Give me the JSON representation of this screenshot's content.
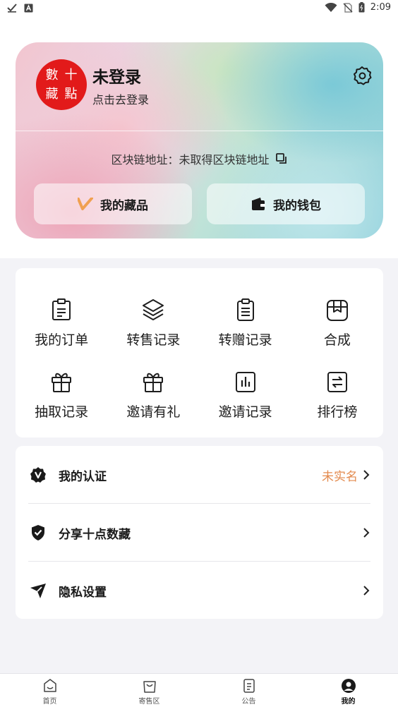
{
  "status_bar": {
    "time": "2:09",
    "left_icons": [
      "check-icon",
      "font-a-icon"
    ],
    "right_icons": [
      "wifi-icon",
      "no-sim-icon",
      "battery-icon"
    ]
  },
  "profile": {
    "avatar_chars": [
      "數",
      "十",
      "藏",
      "點"
    ],
    "name": "未登录",
    "login_hint": "点击去登录",
    "chain_address_label": "区块链地址：未取得区块链地址",
    "collection_button": "我的藏品",
    "wallet_button": "我的钱包"
  },
  "menu_grid": [
    {
      "label": "我的订单",
      "icon": "order-icon"
    },
    {
      "label": "转售记录",
      "icon": "layers-icon"
    },
    {
      "label": "转赠记录",
      "icon": "clipboard-icon"
    },
    {
      "label": "合成",
      "icon": "compose-icon"
    },
    {
      "label": "抽取记录",
      "icon": "gift-icon"
    },
    {
      "label": "邀请有礼",
      "icon": "gift-icon"
    },
    {
      "label": "邀请记录",
      "icon": "chart-icon"
    },
    {
      "label": "排行榜",
      "icon": "ranking-icon"
    }
  ],
  "list": [
    {
      "label": "我的认证",
      "status": "未实名",
      "icon": "verified-badge-icon"
    },
    {
      "label": "分享十点数藏",
      "status": "",
      "icon": "shield-check-icon"
    },
    {
      "label": "隐私设置",
      "status": "",
      "icon": "send-icon"
    }
  ],
  "tabs": [
    {
      "label": "首页",
      "icon": "home-icon"
    },
    {
      "label": "寄售区",
      "icon": "bag-icon"
    },
    {
      "label": "公告",
      "icon": "notice-icon"
    },
    {
      "label": "我的",
      "icon": "profile-icon",
      "active": true
    }
  ],
  "colors": {
    "accent_orange": "#e38a4e",
    "avatar_red": "#e21a1a",
    "page_bg": "#f3f3f7"
  }
}
